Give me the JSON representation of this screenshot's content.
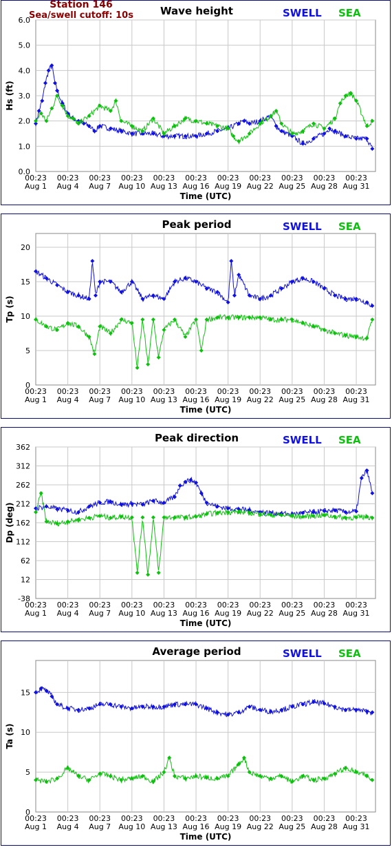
{
  "header": {
    "station": "Station 146",
    "cutoff": "Sea/swell cutoff: 10s"
  },
  "colors": {
    "swell": "#1010e0",
    "sea": "#10c010",
    "grid": "#c8c8c8",
    "border": "#0a0a7a"
  },
  "x_axis": {
    "label": "Time (UTC)",
    "ticks": [
      {
        "time": "00:23",
        "date": "Aug 1",
        "day": 0
      },
      {
        "time": "00:23",
        "date": "Aug 4",
        "day": 3
      },
      {
        "time": "00:23",
        "date": "Aug 7",
        "day": 6
      },
      {
        "time": "00:23",
        "date": "Aug 10",
        "day": 9
      },
      {
        "time": "00:23",
        "date": "Aug 13",
        "day": 12
      },
      {
        "time": "00:23",
        "date": "Aug 16",
        "day": 15
      },
      {
        "time": "00:23",
        "date": "Aug 19",
        "day": 18
      },
      {
        "time": "00:23",
        "date": "Aug 22",
        "day": 21
      },
      {
        "time": "00:23",
        "date": "Aug 25",
        "day": 24
      },
      {
        "time": "00:23",
        "date": "Aug 28",
        "day": 27
      },
      {
        "time": "00:23",
        "date": "Aug 31",
        "day": 30
      }
    ],
    "range_days": [
      0,
      31.8
    ]
  },
  "chart_data": [
    {
      "type": "line",
      "title": "Wave height",
      "ylabel": "Hs (ft)",
      "ylim": [
        0,
        6
      ],
      "yticks": [
        "0.0",
        "1.0",
        "2.0",
        "3.0",
        "4.0",
        "5.0",
        "6.0"
      ],
      "ytick_values": [
        0,
        1,
        2,
        3,
        4,
        5,
        6
      ],
      "legend": [
        "SWELL",
        "SEA"
      ],
      "series": [
        {
          "name": "SWELL",
          "x": [
            0,
            0.3,
            0.6,
            0.9,
            1.2,
            1.5,
            1.8,
            2,
            2.5,
            3,
            3.5,
            4,
            4.5,
            5,
            5.5,
            6,
            7,
            8,
            9,
            10,
            11,
            12,
            13,
            14,
            15,
            16,
            17,
            18,
            19,
            19.5,
            20,
            21,
            22,
            22.5,
            23,
            24,
            25,
            26,
            27,
            27.5,
            28,
            29,
            30,
            31,
            31.5
          ],
          "values": [
            1.9,
            2.4,
            2.8,
            3.5,
            4.0,
            4.2,
            3.5,
            3.2,
            2.7,
            2.3,
            2.1,
            2.0,
            1.9,
            1.8,
            1.6,
            1.8,
            1.7,
            1.6,
            1.5,
            1.5,
            1.5,
            1.4,
            1.4,
            1.4,
            1.4,
            1.5,
            1.6,
            1.7,
            1.9,
            2.0,
            1.9,
            2.0,
            2.2,
            1.8,
            1.6,
            1.4,
            1.1,
            1.3,
            1.5,
            1.7,
            1.6,
            1.4,
            1.3,
            1.3,
            0.9
          ]
        },
        {
          "name": "SEA",
          "x": [
            0,
            0.5,
            1,
            1.5,
            2,
            2.5,
            3,
            3.5,
            4,
            5,
            6,
            7,
            7.5,
            8,
            9,
            10,
            11,
            12,
            13,
            14,
            15,
            16,
            17,
            18,
            18.5,
            19,
            20,
            21,
            22,
            22.5,
            23,
            24,
            25,
            26,
            27,
            28,
            28.5,
            29,
            29.5,
            30,
            31,
            31.5
          ],
          "values": [
            2.0,
            2.3,
            2.0,
            2.5,
            3.0,
            2.6,
            2.2,
            2.1,
            1.9,
            2.2,
            2.6,
            2.4,
            2.8,
            2.0,
            1.8,
            1.6,
            2.1,
            1.5,
            1.8,
            2.1,
            2.0,
            1.9,
            1.8,
            1.7,
            1.4,
            1.2,
            1.5,
            1.9,
            2.2,
            2.4,
            1.9,
            1.5,
            1.6,
            1.9,
            1.7,
            2.1,
            2.7,
            3.0,
            3.1,
            2.8,
            1.8,
            2.0
          ]
        }
      ]
    },
    {
      "type": "line",
      "title": "Peak period",
      "ylabel": "Tp (s)",
      "ylim": [
        0,
        22
      ],
      "yticks": [
        "0",
        "5",
        "10",
        "15",
        "20"
      ],
      "ytick_values": [
        0,
        5,
        10,
        15,
        20
      ],
      "legend": [
        "SWELL",
        "SEA"
      ],
      "series": [
        {
          "name": "SWELL",
          "x": [
            0,
            1,
            2,
            3,
            4,
            5,
            5.3,
            5.6,
            6,
            7,
            8,
            9,
            10,
            11,
            12,
            13,
            14,
            15,
            16,
            17,
            18,
            18.3,
            18.6,
            19,
            20,
            21,
            22,
            23,
            24,
            25,
            26,
            27,
            28,
            29,
            30,
            31,
            31.5
          ],
          "values": [
            16.5,
            15.5,
            14.5,
            13.5,
            13,
            12.5,
            18,
            13,
            15,
            15,
            13.5,
            15,
            12.5,
            13,
            12.5,
            15,
            15.5,
            15,
            14,
            13.5,
            12,
            18,
            13,
            16,
            13,
            12.5,
            13,
            14,
            15,
            15.5,
            15,
            14,
            13,
            12.5,
            12.5,
            12,
            11.5
          ]
        },
        {
          "name": "SEA",
          "x": [
            0,
            1,
            2,
            3,
            4,
            5,
            5.5,
            6,
            7,
            8,
            9,
            9.5,
            10,
            10.5,
            11,
            11.5,
            12,
            13,
            14,
            15,
            15.5,
            16,
            17,
            18,
            19,
            20,
            21,
            22,
            23,
            24,
            25,
            26,
            27,
            28,
            29,
            30,
            31,
            31.5
          ],
          "values": [
            9.5,
            8.5,
            8,
            9,
            8.5,
            7,
            4.5,
            8.5,
            7.5,
            9.5,
            9,
            2.5,
            9.5,
            3,
            9.5,
            4,
            8,
            9.5,
            7,
            9.5,
            5,
            9.5,
            9.8,
            9.8,
            9.8,
            9.8,
            9.8,
            9.5,
            9.5,
            9.5,
            9,
            8.5,
            8,
            7.5,
            7.2,
            7,
            6.8,
            9.5
          ]
        }
      ]
    },
    {
      "type": "line",
      "title": "Peak direction",
      "ylabel": "Dp (deg)",
      "ylim": [
        -38,
        362
      ],
      "yticks": [
        "-38",
        "12",
        "62",
        "112",
        "162",
        "212",
        "262",
        "312",
        "362"
      ],
      "ytick_values": [
        -38,
        12,
        62,
        112,
        162,
        212,
        262,
        312,
        362
      ],
      "legend": [
        "SWELL",
        "SEA"
      ],
      "series": [
        {
          "name": "SWELL",
          "x": [
            0,
            1,
            2,
            3,
            4,
            5,
            6,
            7,
            8,
            9,
            10,
            11,
            12,
            13,
            13.5,
            14,
            14.5,
            15,
            15.5,
            16,
            17,
            18,
            19,
            20,
            21,
            22,
            23,
            24,
            25,
            26,
            27,
            28,
            29,
            30,
            30.5,
            31,
            31.5
          ],
          "values": [
            200,
            205,
            198,
            195,
            190,
            205,
            215,
            218,
            210,
            212,
            210,
            220,
            215,
            230,
            260,
            270,
            275,
            268,
            240,
            215,
            205,
            200,
            198,
            195,
            190,
            188,
            186,
            185,
            188,
            190,
            193,
            195,
            190,
            192,
            280,
            300,
            240
          ]
        },
        {
          "name": "SEA",
          "x": [
            0,
            0.5,
            1,
            2,
            3,
            4,
            5,
            6,
            7,
            8,
            9,
            9.5,
            10,
            10.5,
            11,
            11.5,
            12,
            13,
            14,
            15,
            16,
            17,
            18,
            19,
            20,
            21,
            22,
            23,
            24,
            25,
            26,
            27,
            28,
            29,
            30,
            31,
            31.5
          ],
          "values": [
            190,
            240,
            165,
            160,
            165,
            170,
            175,
            180,
            175,
            178,
            176,
            30,
            176,
            25,
            176,
            30,
            176,
            176,
            176,
            178,
            185,
            188,
            190,
            190,
            188,
            185,
            183,
            182,
            180,
            178,
            180,
            182,
            178,
            175,
            176,
            178,
            175
          ]
        }
      ]
    },
    {
      "type": "line",
      "title": "Average period",
      "ylabel": "Ta (s)",
      "ylim": [
        0,
        19
      ],
      "yticks": [
        "0",
        "5",
        "10",
        "15"
      ],
      "ytick_values": [
        0,
        5,
        10,
        15
      ],
      "legend": [
        "SWELL",
        "SEA"
      ],
      "series": [
        {
          "name": "SWELL",
          "x": [
            0,
            0.5,
            1,
            1.5,
            2,
            3,
            4,
            5,
            6,
            7,
            8,
            9,
            10,
            11,
            12,
            13,
            14,
            15,
            16,
            17,
            18,
            19,
            20,
            21,
            22,
            23,
            24,
            25,
            26,
            27,
            28,
            29,
            30,
            31,
            31.5
          ],
          "values": [
            15,
            15.5,
            15.2,
            14.5,
            13.5,
            13,
            12.8,
            13,
            13.5,
            13.5,
            13.2,
            13,
            13.2,
            13.2,
            13.2,
            13.5,
            13.5,
            13.5,
            13,
            12.5,
            12.2,
            12.5,
            13.2,
            12.8,
            12.6,
            12.8,
            13.2,
            13.5,
            13.8,
            13.6,
            13.2,
            12.8,
            12.8,
            12.6,
            12.5
          ]
        },
        {
          "name": "SEA",
          "x": [
            0,
            1,
            2,
            3,
            4,
            5,
            6,
            7,
            8,
            9,
            10,
            11,
            12,
            12.5,
            13,
            14,
            15,
            16,
            17,
            18,
            19,
            19.5,
            20,
            21,
            22,
            23,
            24,
            25,
            26,
            27,
            28,
            29,
            30,
            31,
            31.5
          ],
          "values": [
            4,
            3.8,
            4.2,
            5.5,
            4.5,
            4,
            4.8,
            4.5,
            4,
            4.2,
            4.5,
            3.8,
            5,
            6.8,
            4.5,
            4.2,
            4.5,
            4.3,
            4.2,
            4.5,
            6,
            6.8,
            5,
            4.5,
            4.2,
            4.5,
            3.8,
            4.5,
            4,
            4.2,
            4.8,
            5.5,
            5,
            4.5,
            4
          ]
        }
      ]
    }
  ]
}
